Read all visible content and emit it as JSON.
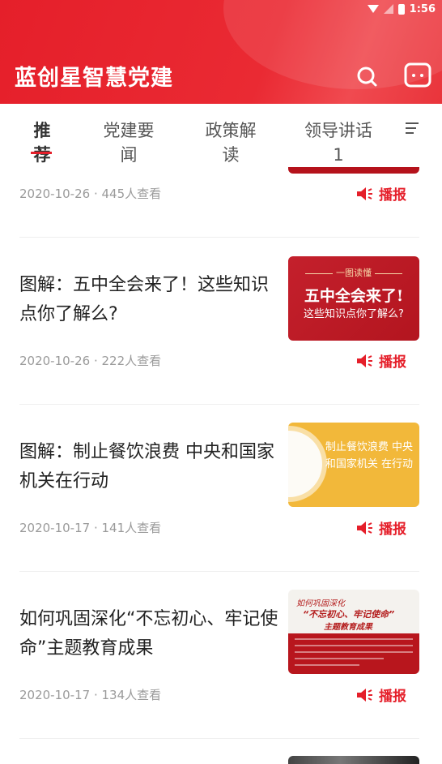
{
  "status_bar": {
    "time": "1:56"
  },
  "header": {
    "title": "蓝创星智慧党建"
  },
  "tabs": [
    {
      "label": "推荐",
      "active": true
    },
    {
      "label": "党建要闻",
      "active": false
    },
    {
      "label": "政策解读",
      "active": false
    },
    {
      "label": "领导讲话1",
      "active": false
    }
  ],
  "colors": {
    "brand": "#e51f2a",
    "meta_text": "#9a9a9a"
  },
  "feed": {
    "broadcast_label": "播报",
    "partial_item": {
      "meta": "2020-10-26 · 445人查看"
    },
    "items": [
      {
        "title": "图解：五中全会来了！这些知识点你了解么?",
        "meta": "2020-10-26 · 222人查看",
        "thumb": {
          "top": "一图读懂",
          "main": "五中全会来了!",
          "sub": "这些知识点你了解么?"
        }
      },
      {
        "title": "图解：制止餐饮浪费 中央和国家机关在行动",
        "meta": "2020-10-17 · 141人查看",
        "thumb": {
          "text": "制止餐饮浪费 中央和国家机关 在行动"
        }
      },
      {
        "title": "如何巩固深化“不忘初心、牢记使命”主题教育成果",
        "meta": "2020-10-17 · 134人查看",
        "thumb": {
          "line1": "如何巩固深化",
          "line2": "“不忘初心、牢记使命”",
          "line3": "主题教育成果"
        }
      }
    ]
  }
}
